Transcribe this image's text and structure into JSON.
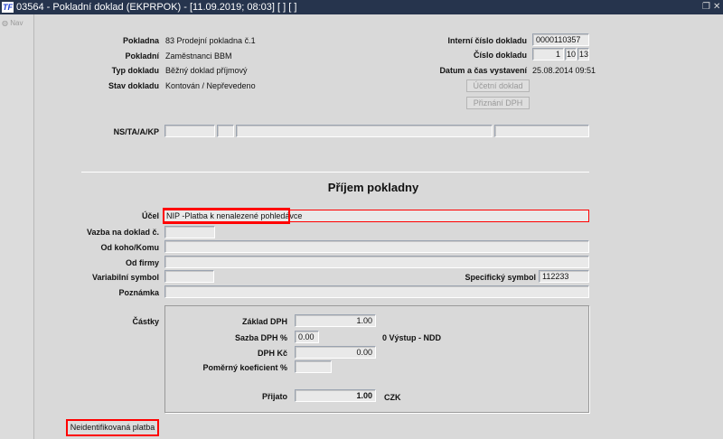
{
  "window": {
    "title": "03564 - Pokladní doklad (EKPRPOK) - [11.09.2019; 08:03]  [ ]  [ ]",
    "logo": "TF"
  },
  "sidebar": {
    "nav": "Nav"
  },
  "header": {
    "pokladna_label": "Pokladna",
    "pokladna": "83 Prodejní pokladna č.1",
    "pokladni_label": "Pokladní",
    "pokladni": "Zaměstnanci BBM",
    "typ_label": "Typ dokladu",
    "typ": "Běžný doklad příjmový",
    "stav_label": "Stav dokladu",
    "stav": "Kontován / Nepřevedeno",
    "interni_label": "Interní číslo dokladu",
    "interni": "0000110357",
    "cislo_label": "Číslo dokladu",
    "cislo": [
      "1",
      "10",
      "13"
    ],
    "datum_label": "Datum a čas vystavení",
    "datum": "25.08.2014 09:51",
    "ucetni_btn": "Účetní doklad",
    "dph_btn": "Přiznání DPH",
    "ns_label": "NS/TA/A/KP"
  },
  "section_title": "Příjem pokladny",
  "form": {
    "ucel_label": "Účel",
    "ucel": "NIP -Platba k nenalezené pohledávce",
    "vazba_label": "Vazba na doklad č.",
    "vazba": "",
    "odkoho_label": "Od koho/Komu",
    "odkoho": "",
    "firma_label": "Od firmy",
    "firma": "",
    "vs_label": "Variabilní symbol",
    "vs": "",
    "ss_label": "Specifický symbol",
    "ss": "112233",
    "pozn_label": "Poznámka",
    "pozn": ""
  },
  "castky": {
    "label": "Částky",
    "zaklad_label": "Základ DPH",
    "zaklad": "1.00",
    "sazba_label": "Sazba DPH %",
    "sazba": "0.00",
    "sazba_note": "0 Výstup  - NDD",
    "dph_label": "DPH Kč",
    "dph": "0.00",
    "pomer_label": "Poměrný koeficient %",
    "pomer": "",
    "prijato_label": "Přijato",
    "prijato": "1.00",
    "mena": "CZK"
  },
  "footer": {
    "neident_btn": "Neidentifikovaná platba"
  },
  "colors": {
    "titlebar": "#26344d",
    "highlight": "#ff0000"
  }
}
